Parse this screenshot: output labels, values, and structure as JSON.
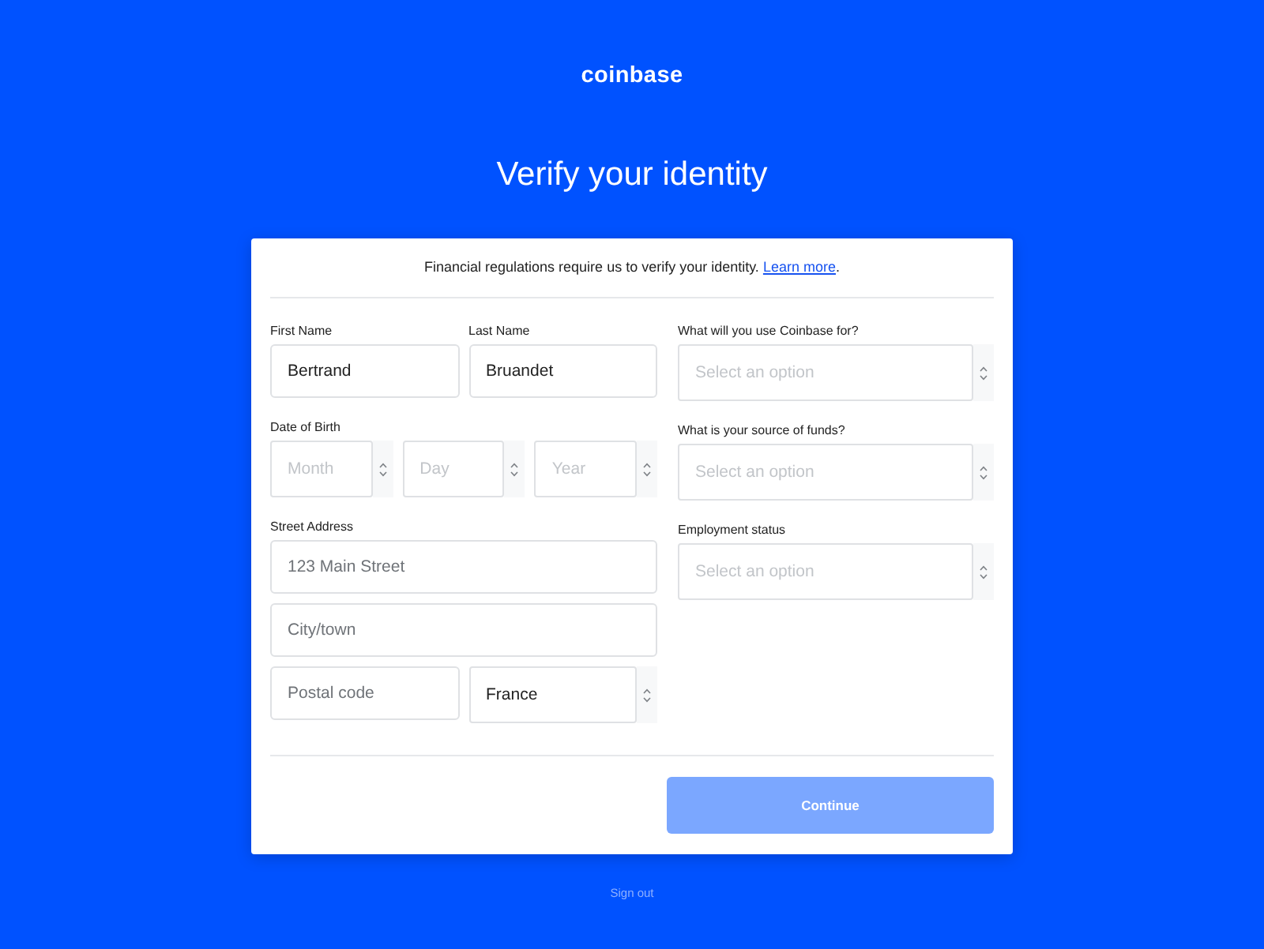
{
  "brand": "coinbase",
  "heading": "Verify your identity",
  "notice": {
    "text": "Financial regulations require us to verify your identity.",
    "link": "Learn more",
    "after": "."
  },
  "form": {
    "left": [
      {
        "rows": [
          [
            {
              "label": "First Name",
              "kind": "input",
              "value": "Bertrand"
            },
            {
              "label": "Last Name",
              "kind": "input",
              "value": "Bruandet"
            }
          ]
        ]
      },
      {
        "label": "Date of Birth",
        "rows": [
          [
            {
              "kind": "select",
              "placeholder": "Month"
            },
            {
              "kind": "select",
              "placeholder": "Day"
            },
            {
              "kind": "select",
              "placeholder": "Year"
            }
          ]
        ]
      },
      {
        "label": "Street Address",
        "rows": [
          [
            {
              "kind": "input",
              "placeholder": "123 Main Street"
            }
          ],
          [
            {
              "kind": "input",
              "placeholder": "City/town"
            }
          ],
          [
            {
              "kind": "input",
              "placeholder": "Postal code"
            },
            {
              "kind": "select",
              "value": "France"
            }
          ]
        ]
      }
    ],
    "right": [
      {
        "label": "What will you use Coinbase for?",
        "rows": [
          [
            {
              "kind": "select",
              "placeholder": "Select an option"
            }
          ]
        ]
      },
      {
        "label": "What is your source of funds?",
        "rows": [
          [
            {
              "kind": "select",
              "placeholder": "Select an option"
            }
          ]
        ]
      },
      {
        "label": "Employment status",
        "rows": [
          [
            {
              "kind": "select",
              "placeholder": "Select an option"
            }
          ]
        ]
      }
    ]
  },
  "submit": {
    "label": "Continue",
    "disabled": true
  },
  "sign_out": "Sign out"
}
